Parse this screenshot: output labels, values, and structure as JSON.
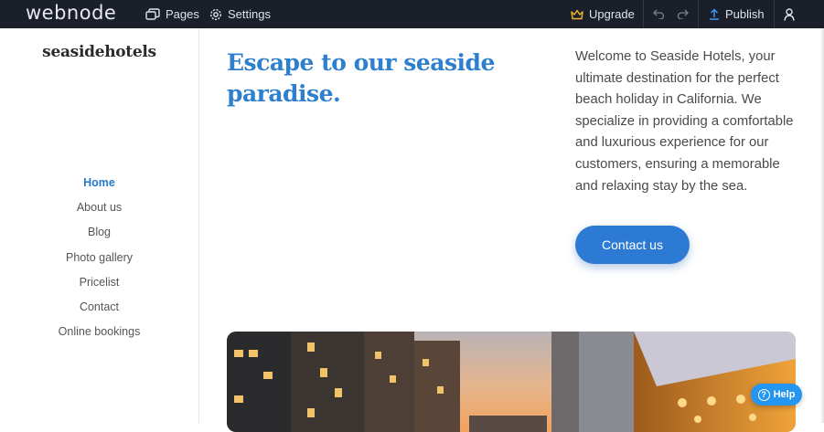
{
  "app": {
    "logo": "webnode",
    "pages_label": "Pages",
    "settings_label": "Settings",
    "upgrade_label": "Upgrade",
    "publish_label": "Publish",
    "icons": [
      "pages-icon",
      "settings-gear-icon",
      "crown-icon",
      "undo-icon",
      "redo-icon",
      "upload-icon",
      "user-icon"
    ],
    "accent_color": "#2d7ad4",
    "crown_color": "#f0b52a"
  },
  "site": {
    "title": "seasidehotels",
    "nav": [
      {
        "label": "Home",
        "active": true
      },
      {
        "label": "About us"
      },
      {
        "label": "Blog"
      },
      {
        "label": "Photo gallery"
      },
      {
        "label": "Pricelist"
      },
      {
        "label": "Contact"
      },
      {
        "label": "Online bookings"
      }
    ]
  },
  "hero": {
    "heading": "Escape to our seaside paradise.",
    "intro": "Welcome to Seaside Hotels, your ultimate destination for the perfect beach holiday in California. We specialize in providing a comfortable and luxurious experience for our customers, ensuring a memorable and relaxing stay by the sea.",
    "cta_label": "Contact us",
    "heading_color": "#2f7fcf"
  },
  "help": {
    "label": "Help"
  }
}
